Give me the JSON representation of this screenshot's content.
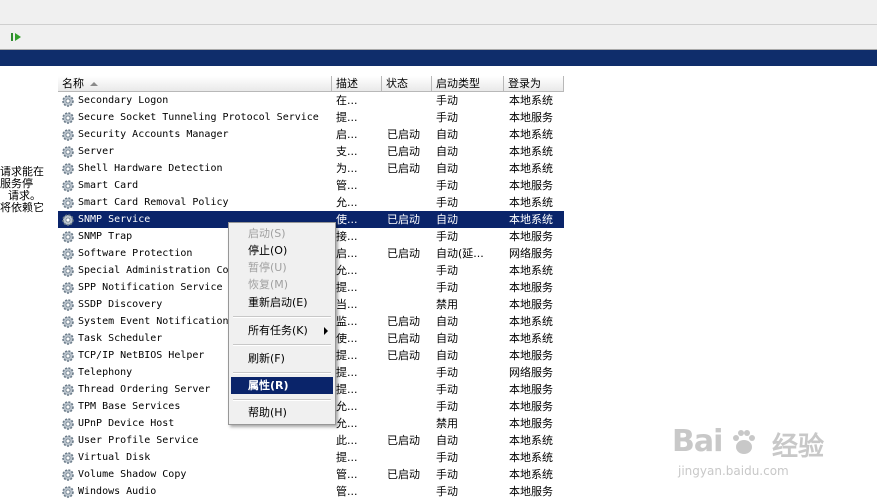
{
  "columns": {
    "name": "名称",
    "desc": "描述",
    "status": "状态",
    "start": "启动类型",
    "logon": "登录为"
  },
  "left_desc": [
    "请求能在",
    "服务停",
    "请求。",
    "将依赖它"
  ],
  "services": [
    {
      "name": "Secondary Logon",
      "desc": "在...",
      "status": "",
      "start": "手动",
      "logon": "本地系统"
    },
    {
      "name": "Secure Socket Tunneling Protocol Service",
      "desc": "提...",
      "status": "",
      "start": "手动",
      "logon": "本地服务"
    },
    {
      "name": "Security Accounts Manager",
      "desc": "启...",
      "status": "已启动",
      "start": "自动",
      "logon": "本地系统"
    },
    {
      "name": "Server",
      "desc": "支...",
      "status": "已启动",
      "start": "自动",
      "logon": "本地系统"
    },
    {
      "name": "Shell Hardware Detection",
      "desc": "为...",
      "status": "已启动",
      "start": "自动",
      "logon": "本地系统"
    },
    {
      "name": "Smart Card",
      "desc": "管...",
      "status": "",
      "start": "手动",
      "logon": "本地服务"
    },
    {
      "name": "Smart Card Removal Policy",
      "desc": "允...",
      "status": "",
      "start": "手动",
      "logon": "本地系统"
    },
    {
      "name": "SNMP Service",
      "desc": "使...",
      "status": "已启动",
      "start": "自动",
      "logon": "本地系统",
      "selected": true
    },
    {
      "name": "SNMP Trap",
      "desc": "接...",
      "status": "",
      "start": "手动",
      "logon": "本地服务"
    },
    {
      "name": "Software Protection",
      "desc": "启...",
      "status": "已启动",
      "start": "自动(延...",
      "logon": "网络服务"
    },
    {
      "name": "Special Administration Co",
      "desc": "允...",
      "status": "",
      "start": "手动",
      "logon": "本地系统"
    },
    {
      "name": "SPP Notification Service",
      "desc": "提...",
      "status": "",
      "start": "手动",
      "logon": "本地服务"
    },
    {
      "name": "SSDP Discovery",
      "desc": "当...",
      "status": "",
      "start": "禁用",
      "logon": "本地服务"
    },
    {
      "name": "System Event Notification",
      "desc": "监...",
      "status": "已启动",
      "start": "自动",
      "logon": "本地系统"
    },
    {
      "name": "Task Scheduler",
      "desc": "使...",
      "status": "已启动",
      "start": "自动",
      "logon": "本地系统"
    },
    {
      "name": "TCP/IP NetBIOS Helper",
      "desc": "提...",
      "status": "已启动",
      "start": "自动",
      "logon": "本地服务"
    },
    {
      "name": "Telephony",
      "desc": "提...",
      "status": "",
      "start": "手动",
      "logon": "网络服务"
    },
    {
      "name": "Thread Ordering Server",
      "desc": "提...",
      "status": "",
      "start": "手动",
      "logon": "本地服务"
    },
    {
      "name": "TPM Base Services",
      "desc": "允...",
      "status": "",
      "start": "手动",
      "logon": "本地服务"
    },
    {
      "name": "UPnP Device Host",
      "desc": "允...",
      "status": "",
      "start": "禁用",
      "logon": "本地服务"
    },
    {
      "name": "User Profile Service",
      "desc": "此...",
      "status": "已启动",
      "start": "自动",
      "logon": "本地系统"
    },
    {
      "name": "Virtual Disk",
      "desc": "提...",
      "status": "",
      "start": "手动",
      "logon": "本地系统"
    },
    {
      "name": "Volume Shadow Copy",
      "desc": "管...",
      "status": "已启动",
      "start": "手动",
      "logon": "本地系统"
    },
    {
      "name": "Windows Audio",
      "desc": "管...",
      "status": "",
      "start": "手动",
      "logon": "本地服务"
    }
  ],
  "context_menu": {
    "start": "启动(S)",
    "stop": "停止(O)",
    "pause": "暂停(U)",
    "resume": "恢复(M)",
    "restart": "重新启动(E)",
    "all_tasks": "所有任务(K)",
    "refresh": "刷新(F)",
    "properties": "属性(R)",
    "help": "帮助(H)"
  },
  "watermark": {
    "logo": "Bai",
    "cn": "经验",
    "url": "jingyan.baidu.com"
  },
  "colors": {
    "selection": "#0a246a",
    "band": "#0f2d6b"
  }
}
